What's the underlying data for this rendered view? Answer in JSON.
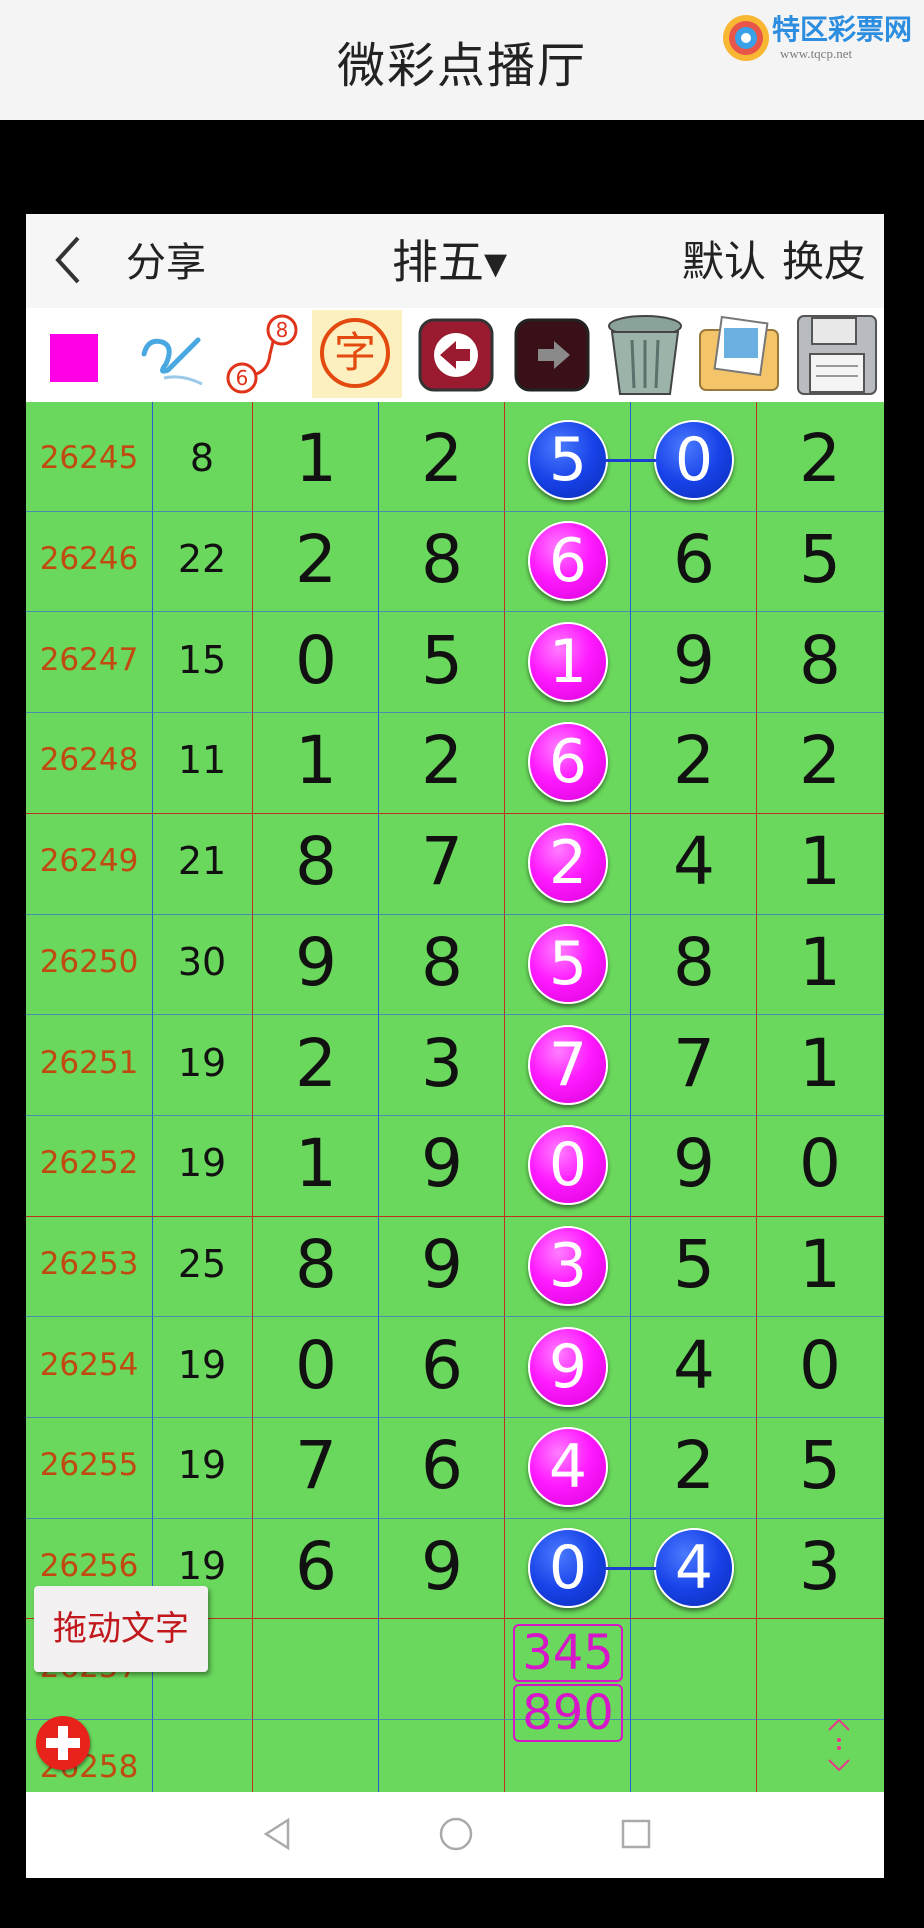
{
  "topbar": {
    "title": "微彩点播厅",
    "brand_name": "特区彩票网",
    "brand_url": "www.tqcp.net"
  },
  "header": {
    "share_label": "分享",
    "game_select": "排五▾",
    "default_label": "默认",
    "skin_label": "换皮"
  },
  "toolbar": {
    "tools": [
      "color-square-icon",
      "pen-check-icon",
      "number-link-icon",
      "character-icon",
      "undo-arrow-icon",
      "redo-arrow-icon",
      "trash-can-icon",
      "photo-album-icon",
      "floppy-save-icon"
    ],
    "char_label": "字",
    "link_top": "8",
    "link_bottom": "6",
    "color_swatch": "#ff00e6"
  },
  "rows": [
    {
      "issue": "26245",
      "sum": "8",
      "d": [
        "1",
        "2",
        "5",
        "0",
        "2"
      ],
      "balls": {
        "2": "blue",
        "3": "blue"
      }
    },
    {
      "issue": "26246",
      "sum": "22",
      "d": [
        "2",
        "8",
        "6",
        "6",
        "5"
      ],
      "balls": {
        "2": "pink"
      }
    },
    {
      "issue": "26247",
      "sum": "15",
      "d": [
        "0",
        "5",
        "1",
        "9",
        "8"
      ],
      "balls": {
        "2": "pink"
      }
    },
    {
      "issue": "26248",
      "sum": "11",
      "d": [
        "1",
        "2",
        "6",
        "2",
        "2"
      ],
      "balls": {
        "2": "pink"
      }
    },
    {
      "issue": "26249",
      "sum": "21",
      "d": [
        "8",
        "7",
        "2",
        "4",
        "1"
      ],
      "balls": {
        "2": "pink"
      }
    },
    {
      "issue": "26250",
      "sum": "30",
      "d": [
        "9",
        "8",
        "5",
        "8",
        "1"
      ],
      "balls": {
        "2": "pink"
      }
    },
    {
      "issue": "26251",
      "sum": "19",
      "d": [
        "2",
        "3",
        "7",
        "7",
        "1"
      ],
      "balls": {
        "2": "pink"
      }
    },
    {
      "issue": "26252",
      "sum": "19",
      "d": [
        "1",
        "9",
        "0",
        "9",
        "0"
      ],
      "balls": {
        "2": "pink"
      }
    },
    {
      "issue": "26253",
      "sum": "25",
      "d": [
        "8",
        "9",
        "3",
        "5",
        "1"
      ],
      "balls": {
        "2": "pink"
      }
    },
    {
      "issue": "26254",
      "sum": "19",
      "d": [
        "0",
        "6",
        "9",
        "4",
        "0"
      ],
      "balls": {
        "2": "pink"
      }
    },
    {
      "issue": "26255",
      "sum": "19",
      "d": [
        "7",
        "6",
        "4",
        "2",
        "5"
      ],
      "balls": {
        "2": "pink"
      }
    },
    {
      "issue": "26256",
      "sum": "19",
      "d": [
        "6",
        "9",
        "0",
        "4",
        "3"
      ],
      "balls": {
        "2": "blue",
        "3": "blue"
      }
    },
    {
      "issue": "26257",
      "sum": "",
      "d": [
        "",
        "",
        "",
        "",
        ""
      ],
      "balls": {}
    },
    {
      "issue": "26258",
      "sum": "",
      "d": [
        "",
        "",
        "",
        "",
        ""
      ],
      "balls": {}
    }
  ],
  "pending": [
    "345",
    "890"
  ],
  "drag_text_label": "拖动文字",
  "colors": {
    "grid": "#6ad85c",
    "pink_ball": "#ff1aff",
    "blue_ball": "#1842e8",
    "issue_text": "#c04a10"
  }
}
